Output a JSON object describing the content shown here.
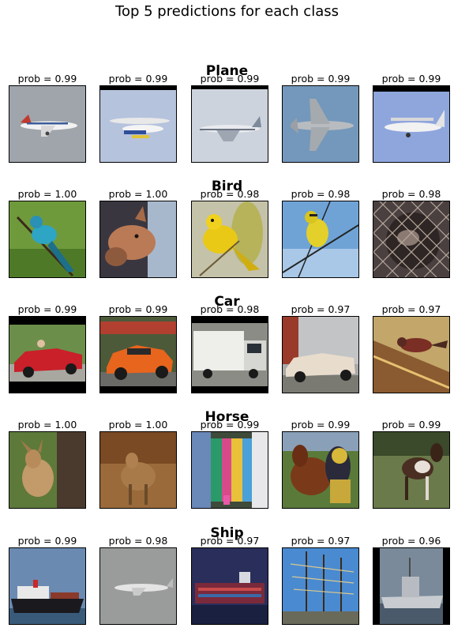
{
  "figure_title": "Top 5 predictions for each class",
  "classes": [
    {
      "name": "Plane",
      "items": [
        {
          "prob": "prob = 0.99",
          "image": "airliner-in-grey-sky"
        },
        {
          "prob": "prob = 0.99",
          "image": "small-prop-plane-blue-sky"
        },
        {
          "prob": "prob = 0.99",
          "image": "jumbo-jet-pale-sky"
        },
        {
          "prob": "prob = 0.99",
          "image": "military-jet-blue-sky"
        },
        {
          "prob": "prob = 0.99",
          "image": "turboprop-blue-sky"
        }
      ]
    },
    {
      "name": "Bird",
      "items": [
        {
          "prob": "prob = 1.00",
          "image": "blue-bird-on-branch"
        },
        {
          "prob": "prob = 1.00",
          "image": "horse-head-closeup"
        },
        {
          "prob": "prob = 0.98",
          "image": "yellow-warbler-in-foliage"
        },
        {
          "prob": "prob = 0.98",
          "image": "yellow-bird-on-wire"
        },
        {
          "prob": "prob = 0.98",
          "image": "monkey-behind-fence"
        }
      ]
    },
    {
      "name": "Car",
      "items": [
        {
          "prob": "prob = 0.99",
          "image": "red-convertible"
        },
        {
          "prob": "prob = 0.99",
          "image": "orange-sports-car"
        },
        {
          "prob": "prob = 0.98",
          "image": "white-truck"
        },
        {
          "prob": "prob = 0.97",
          "image": "cream-convertible"
        },
        {
          "prob": "prob = 0.97",
          "image": "bird-on-car-hood"
        }
      ]
    },
    {
      "name": "Horse",
      "items": [
        {
          "prob": "prob = 1.00",
          "image": "deer-by-tree"
        },
        {
          "prob": "prob = 1.00",
          "image": "deer-in-forest"
        },
        {
          "prob": "prob = 0.99",
          "image": "decorated-horse-parade"
        },
        {
          "prob": "prob = 0.99",
          "image": "knight-on-horse"
        },
        {
          "prob": "prob = 0.99",
          "image": "foal-in-field"
        }
      ]
    },
    {
      "name": "Ship",
      "items": [
        {
          "prob": "prob = 0.99",
          "image": "cargo-ship"
        },
        {
          "prob": "prob = 0.98",
          "image": "airliner-in-grey-sky"
        },
        {
          "prob": "prob = 0.97",
          "image": "container-ship-at-night"
        },
        {
          "prob": "prob = 0.97",
          "image": "tall-ship-masts"
        },
        {
          "prob": "prob = 0.96",
          "image": "grey-naval-ship"
        }
      ]
    }
  ]
}
